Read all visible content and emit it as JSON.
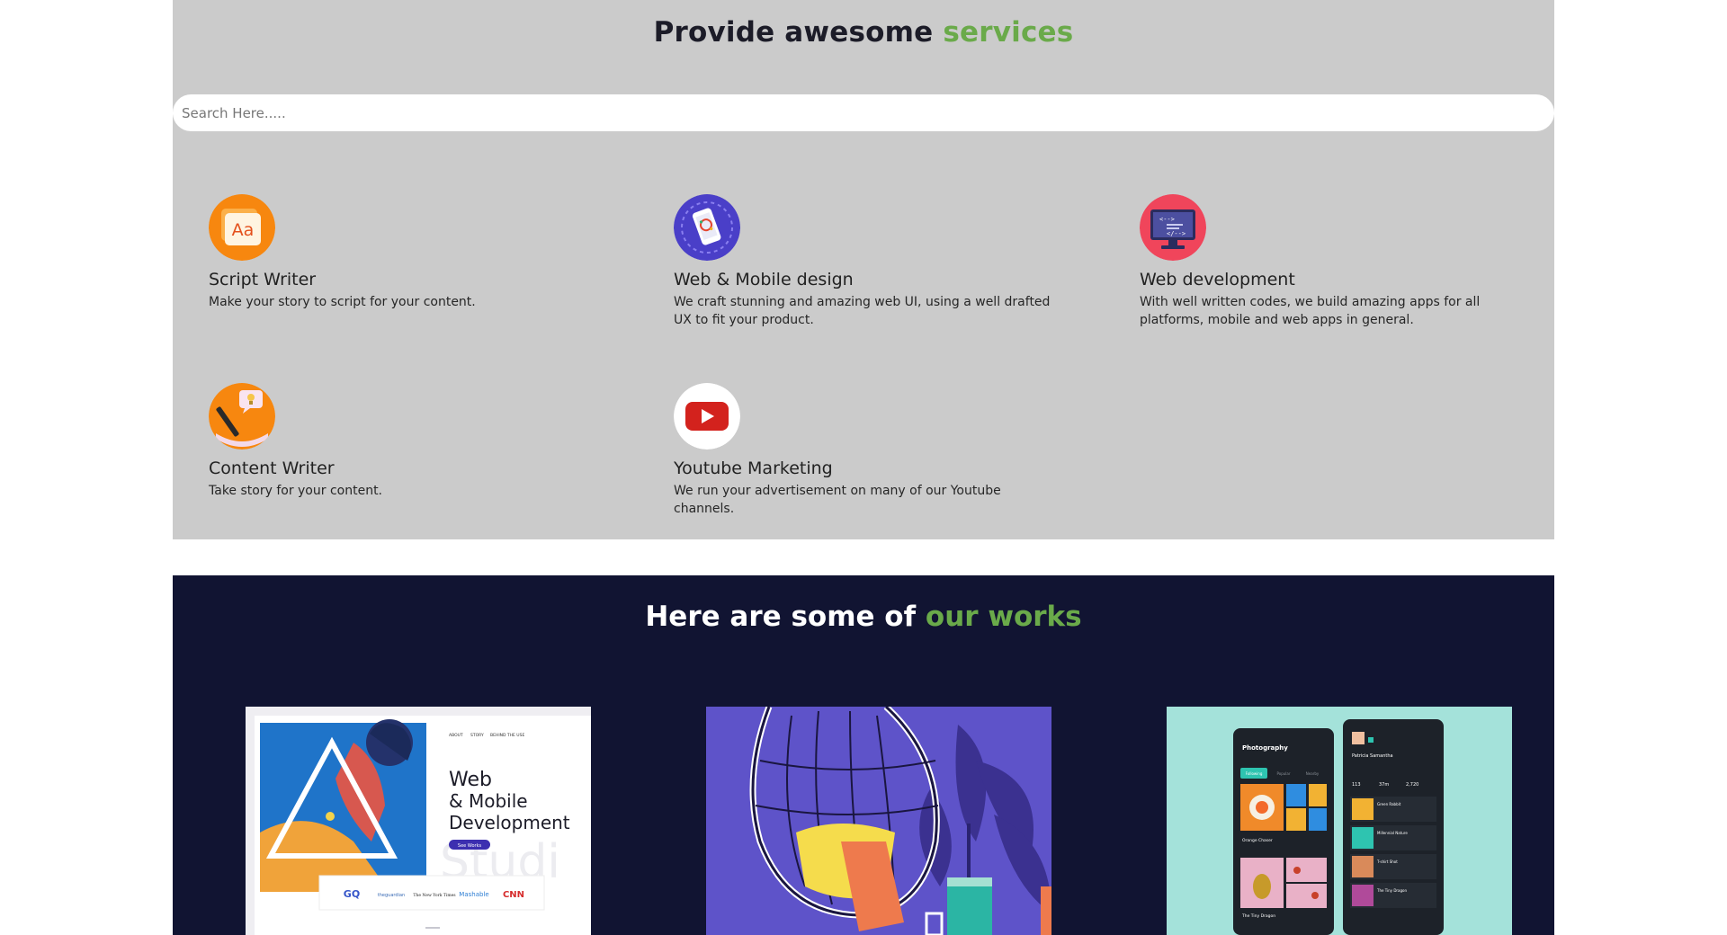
{
  "services": {
    "title_main": "Provide awesome ",
    "title_accent": "services",
    "search_placeholder": "Search Here.....",
    "items": [
      {
        "title": "Script Writer",
        "desc": "Make your story to script for your content.",
        "icon": "script-writer-icon"
      },
      {
        "title": "Web & Mobile design",
        "desc": "We craft stunning and amazing web UI, using a well drafted UX to fit your product.",
        "icon": "mobile-design-icon"
      },
      {
        "title": "Web development",
        "desc": "With well written codes, we build amazing apps for all platforms, mobile and web apps in general.",
        "icon": "code-monitor-icon"
      },
      {
        "title": "Content Writer",
        "desc": "Take story for your content.",
        "icon": "content-writer-icon"
      },
      {
        "title": "Youtube Marketing",
        "desc": "We run your advertisement on many of our Youtube channels.",
        "icon": "youtube-icon"
      }
    ]
  },
  "works": {
    "title_main": "Here are some of ",
    "title_accent": "our works",
    "cards": [
      {
        "name": "web-mobile-development-mockup",
        "nav": [
          "ABOUT",
          "STORY",
          "BEHIND THE USE"
        ],
        "headline": [
          "Web",
          "& Mobile",
          "Development"
        ],
        "button": "See Works",
        "watermark": "Studi",
        "logos": [
          "GQ",
          "theguardian",
          "The New York Times",
          "Mashable",
          "CNN"
        ]
      },
      {
        "name": "hanging-chair-illustration"
      },
      {
        "name": "photography-app-mockup",
        "left_title": "Photography",
        "tabs": [
          "Following",
          "Popular",
          "Nearby"
        ],
        "left_labels": [
          "Orange Chaser",
          "The Tiny Dragon"
        ],
        "profile_name": "Patricia Samantha",
        "stats": [
          "113",
          "37m",
          "2,720"
        ],
        "list": [
          "Green Rabbit",
          "Millennial Nature",
          "T-shirt Shot",
          "The Tiny Dragon"
        ]
      }
    ]
  },
  "colors": {
    "services_bg": "#cbcbcb",
    "works_bg": "#111432",
    "accent": "#6aaa4a"
  }
}
